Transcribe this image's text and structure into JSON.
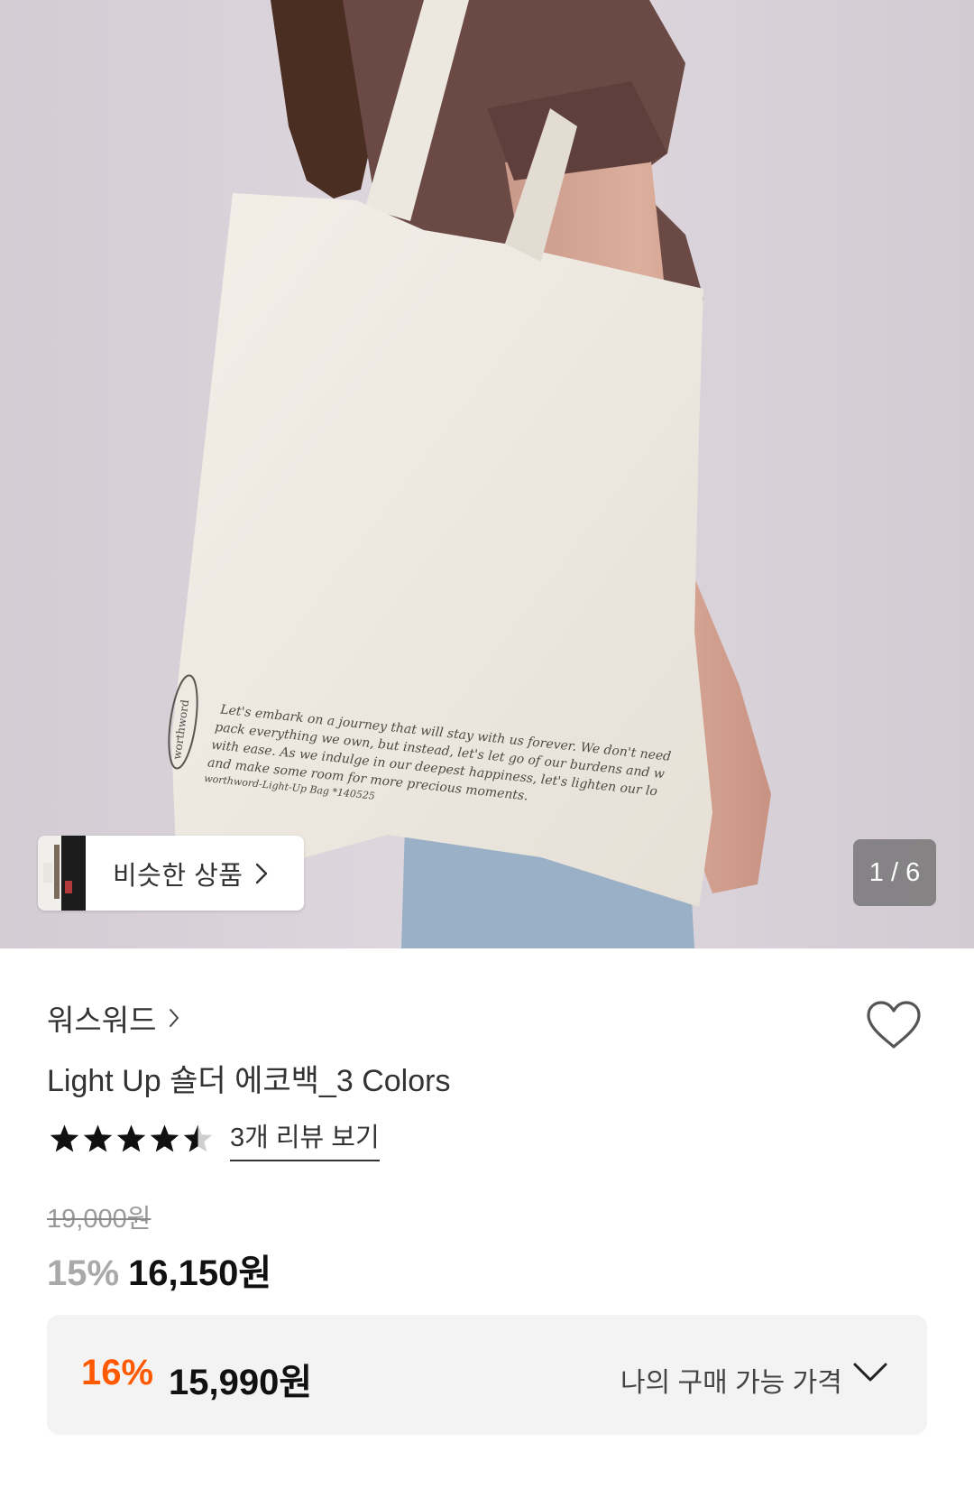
{
  "gallery": {
    "counter": "1 / 6",
    "similar_label": "비슷한 상품",
    "bag_print": {
      "brand_mark": "worthword",
      "lines": [
        "Let's embark on a journey that will stay with us forever. We don't need",
        "pack everything we own, but instead, let's let go of our burdens and w",
        "with ease. As we indulge in our deepest happiness, let's lighten our lo",
        "and make some room for more precious moments.",
        "worthword-Light-Up Bag *140525"
      ]
    }
  },
  "product": {
    "brand": "워스워드",
    "title": "Light Up 숄더 에코백_3 Colors",
    "rating": 4.5,
    "review_link": "3개 리뷰 보기",
    "original_price": "19,000원",
    "discount": "15%",
    "price": "16,150원"
  },
  "my_price": {
    "discount": "16%",
    "price": "15,990원",
    "label": "나의 구매 가능 가격"
  },
  "icons": {
    "wishlist": "heart-outline-icon",
    "brand_chevron": "chevron-right-icon",
    "similar_chevron": "chevron-right-icon",
    "my_price_chevron": "chevron-down-icon"
  },
  "colors": {
    "accent_orange": "#ff5a00",
    "muted_discount": "#a9a9a9",
    "box_bg": "#f3f3f3"
  }
}
